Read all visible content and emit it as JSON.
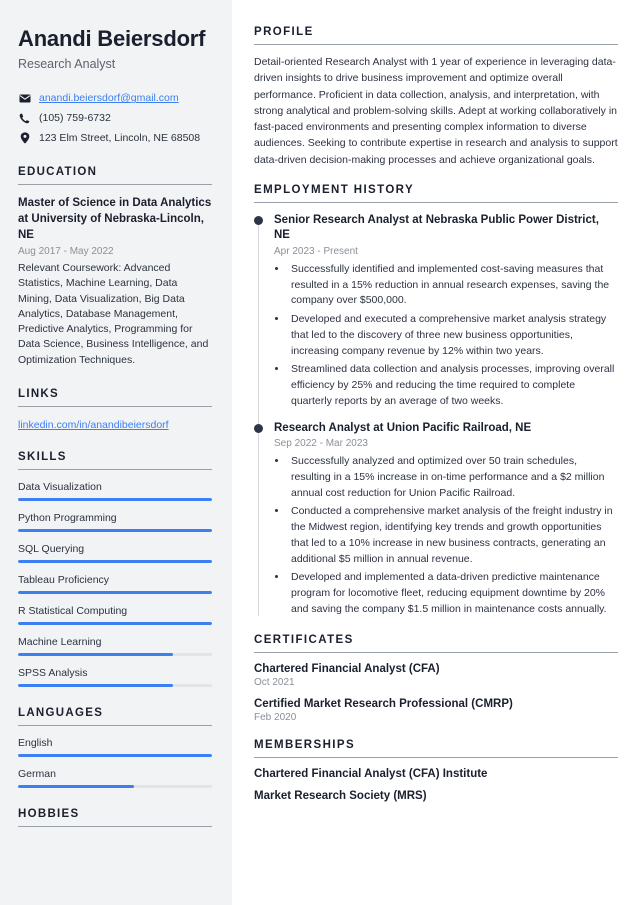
{
  "sidebar": {
    "name": "Anandi Beiersdorf",
    "job_title": "Research Analyst",
    "contacts": [
      {
        "icon": "envelope-icon",
        "text": "anandi.beiersdorf@gmail.com",
        "is_link": true
      },
      {
        "icon": "phone-icon",
        "text": "(105) 759-6732",
        "is_link": false
      },
      {
        "icon": "location-pin-icon",
        "text": "123 Elm Street, Lincoln, NE 68508",
        "is_link": false
      }
    ],
    "education": {
      "heading": "EDUCATION",
      "degree": "Master of Science in Data Analytics at University of Nebraska-Lincoln, NE",
      "date": "Aug 2017 - May 2022",
      "description": "Relevant Coursework: Advanced Statistics, Machine Learning, Data Mining, Data Visualization, Big Data Analytics, Database Management, Predictive Analytics, Programming for Data Science, Business Intelligence, and Optimization Techniques."
    },
    "links": {
      "heading": "LINKS",
      "items": [
        {
          "label": "linkedin.com/in/anandibeiersdorf"
        }
      ]
    },
    "skills": {
      "heading": "SKILLS",
      "items": [
        {
          "label": "Data Visualization",
          "level": 100
        },
        {
          "label": "Python Programming",
          "level": 100
        },
        {
          "label": "SQL Querying",
          "level": 100
        },
        {
          "label": "Tableau Proficiency",
          "level": 100
        },
        {
          "label": "R Statistical Computing",
          "level": 100
        },
        {
          "label": "Machine Learning",
          "level": 80
        },
        {
          "label": "SPSS Analysis",
          "level": 80
        }
      ]
    },
    "languages": {
      "heading": "LANGUAGES",
      "items": [
        {
          "label": "English",
          "level": 100
        },
        {
          "label": "German",
          "level": 60
        }
      ]
    },
    "hobbies": {
      "heading": "HOBBIES"
    }
  },
  "main": {
    "profile": {
      "heading": "PROFILE",
      "text": "Detail-oriented Research Analyst with 1 year of experience in leveraging data-driven insights to drive business improvement and optimize overall performance. Proficient in data collection, analysis, and interpretation, with strong analytical and problem-solving skills. Adept at working collaboratively in fast-paced environments and presenting complex information to diverse audiences. Seeking to contribute expertise in research and analysis to support data-driven decision-making processes and achieve organizational goals."
    },
    "employment": {
      "heading": "EMPLOYMENT HISTORY",
      "jobs": [
        {
          "role": "Senior Research Analyst at Nebraska Public Power District, NE",
          "date": "Apr 2023 - Present",
          "points": [
            "Successfully identified and implemented cost-saving measures that resulted in a 15% reduction in annual research expenses, saving the company over $500,000.",
            "Developed and executed a comprehensive market analysis strategy that led to the discovery of three new business opportunities, increasing company revenue by 12% within two years.",
            "Streamlined data collection and analysis processes, improving overall efficiency by 25% and reducing the time required to complete quarterly reports by an average of two weeks."
          ]
        },
        {
          "role": "Research Analyst at Union Pacific Railroad, NE",
          "date": "Sep 2022 - Mar 2023",
          "points": [
            "Successfully analyzed and optimized over 50 train schedules, resulting in a 15% increase in on-time performance and a $2 million annual cost reduction for Union Pacific Railroad.",
            "Conducted a comprehensive market analysis of the freight industry in the Midwest region, identifying key trends and growth opportunities that led to a 10% increase in new business contracts, generating an additional $5 million in annual revenue.",
            "Developed and implemented a data-driven predictive maintenance program for locomotive fleet, reducing equipment downtime by 20% and saving the company $1.5 million in maintenance costs annually."
          ]
        }
      ]
    },
    "certificates": {
      "heading": "CERTIFICATES",
      "items": [
        {
          "title": "Chartered Financial Analyst (CFA)",
          "date": "Oct 2021"
        },
        {
          "title": "Certified Market Research Professional (CMRP)",
          "date": "Feb 2020"
        }
      ]
    },
    "memberships": {
      "heading": "MEMBERSHIPS",
      "items": [
        {
          "title": "Chartered Financial Analyst (CFA) Institute"
        },
        {
          "title": "Market Research Society (MRS)"
        }
      ]
    }
  },
  "colors": {
    "accent": "#3b7ff2",
    "heading": "#1b1f2e",
    "sidebar_bg": "#f1f3f4",
    "muted": "#8a9099"
  }
}
